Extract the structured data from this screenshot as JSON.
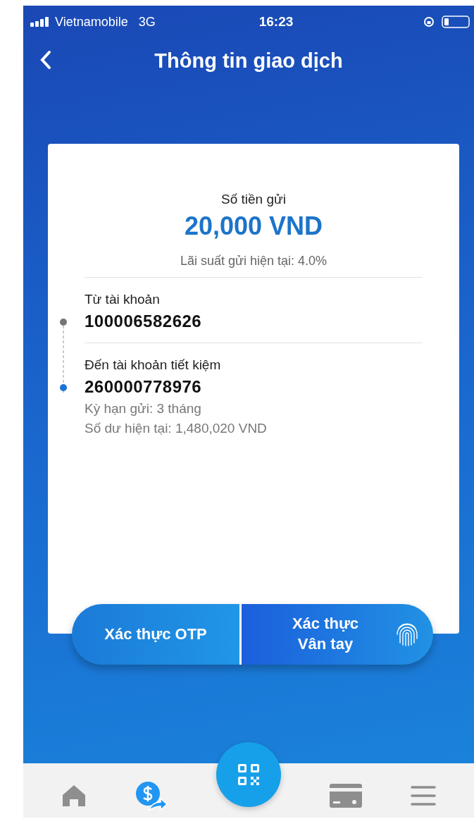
{
  "status_bar": {
    "carrier": "Vietnamobile",
    "network": "3G",
    "time": "16:23"
  },
  "header": {
    "title": "Thông tin giao dịch"
  },
  "amount": {
    "label": "Số tiền gửi",
    "value": "20,000 VND",
    "rate": "Lãi suất gửi hiện tại: 4.0%"
  },
  "accounts": [
    {
      "label": "Từ tài khoản",
      "number": "100006582626",
      "color": "#757575"
    },
    {
      "label": "Đến tài khoản tiết kiệm",
      "number": "260000778976",
      "details": [
        "Kỳ hạn gửi: 3 tháng",
        "Số dư hiện tại: 1,480,020 VND"
      ],
      "color": "#1a73d9"
    }
  ],
  "actions": [
    {
      "label": "Xác thực OTP",
      "kind": "otp"
    },
    {
      "label": "Xác thực\nVân tay",
      "kind": "fingerprint"
    }
  ],
  "tab_bar": [
    {
      "selected": false
    },
    {
      "selected": true
    },
    {
      "selected": false
    },
    {
      "selected": false
    },
    {
      "selected": false
    }
  ]
}
